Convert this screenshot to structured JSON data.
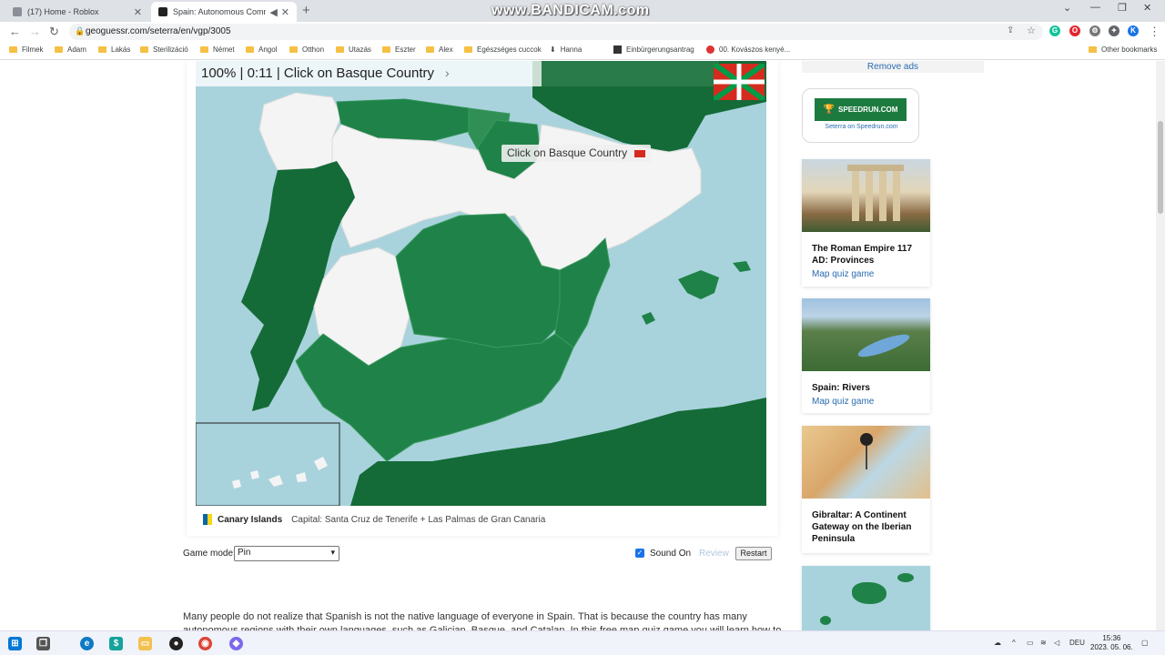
{
  "browser": {
    "tabs": [
      {
        "title": "(17) Home - Roblox",
        "active": false
      },
      {
        "title": "Spain: Autonomous Commu",
        "active": true
      }
    ],
    "new_tab_label": "+",
    "url": "geoguessr.com/seterra/en/vgp/3005",
    "watermark": "www.BANDICAM.com",
    "bookmarks": [
      "Filmek",
      "Adam",
      "Lakás",
      "Sterilizáció",
      "Német",
      "Angol",
      "Otthon",
      "Utazás",
      "Eszter",
      "Alex",
      "Egészséges cuccok",
      "Hanna",
      "Einbürgerungsantrag",
      "00. Kovászos kenyé..."
    ],
    "other_bookmarks": "Other bookmarks",
    "profile_initial": "K"
  },
  "game": {
    "status": "100% | 0:11 | Click on Basque Country",
    "tooltip": "Click on Basque Country",
    "info": {
      "region": "Canary Islands",
      "capital": "Capital: Santa Cruz de Tenerife + Las Palmas de Gran Canaria"
    },
    "controls": {
      "game_mode_label": "Game mode:",
      "game_mode_value": "Pin",
      "sound_label": "Sound On",
      "sound_checked": true,
      "review_label": "Review",
      "restart_label": "Restart"
    },
    "colors": {
      "sea": "#a8d3dc",
      "correct": "#1f8248",
      "unanswered": "#f4f4f4",
      "foreign": "#146b38"
    }
  },
  "description": "Many people do not realize that Spanish is not the native language of everyone in Spain. That is because the country has many autonomous regions with their own languages, such as Galician, Basque, and Catalan. In this free map quiz game you will learn how to identify the",
  "sidebar": {
    "remove_ads": "Remove ads",
    "speedrun": {
      "logo": "SPEEDRUN.COM",
      "link": "Seterra on Speedrun.com"
    },
    "cards": [
      {
        "title": "The Roman Empire 117 AD: Provinces",
        "link": "Map quiz game"
      },
      {
        "title": "Spain: Rivers",
        "link": "Map quiz game"
      },
      {
        "title": "Gibraltar: A Continent Gateway on the Iberian Peninsula",
        "link": ""
      }
    ]
  },
  "taskbar": {
    "language": "DEU",
    "time": "15:36",
    "date": "2023. 05. 06."
  }
}
